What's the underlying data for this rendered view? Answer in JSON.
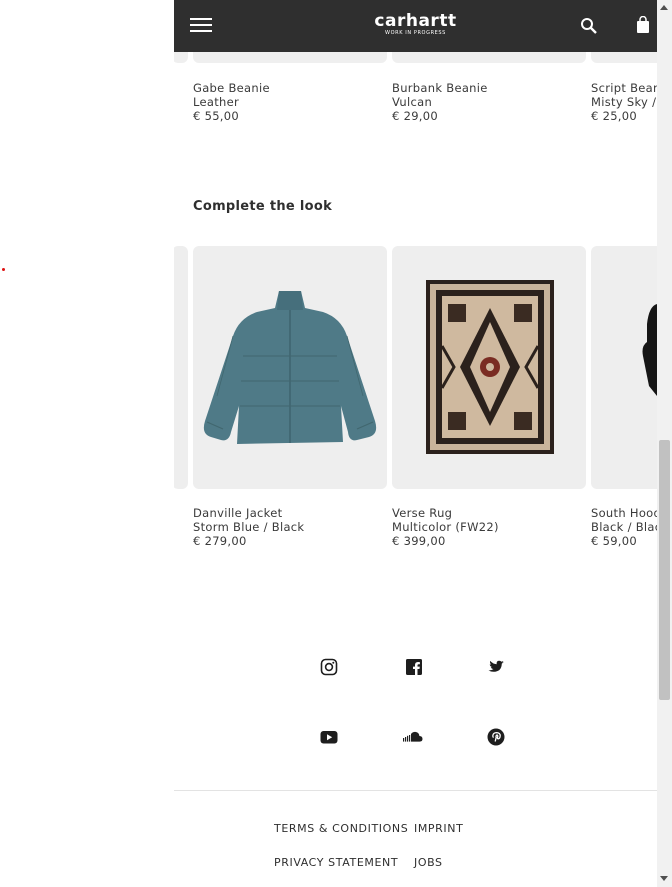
{
  "header": {
    "logo_main": "carhartt",
    "logo_sub": "WORK IN PROGRESS"
  },
  "recent_products": [
    {
      "name": "Gabe Beanie",
      "variant": "Leather",
      "price": "€ 55,00"
    },
    {
      "name": "Burbank Beanie",
      "variant": "Vulcan",
      "price": "€ 29,00"
    },
    {
      "name": "Script Beanie",
      "variant": "Misty Sky /",
      "price": "€ 25,00"
    }
  ],
  "section_title": "Complete the look",
  "look_products": [
    {
      "name": "Danville Jacket",
      "variant": "Storm Blue / Black",
      "price": "€ 279,00"
    },
    {
      "name": "Verse Rug",
      "variant": "Multicolor (FW22)",
      "price": "€ 399,00"
    },
    {
      "name": "South Hood",
      "variant": "Black / Black",
      "price": "€ 59,00"
    }
  ],
  "social_icons": [
    "instagram-icon",
    "facebook-icon",
    "twitter-icon",
    "youtube-icon",
    "soundcloud-icon",
    "pinterest-icon"
  ],
  "footer": {
    "terms": "TERMS & CONDITIONS",
    "imprint": "IMPRINT",
    "privacy": "PRIVACY STATEMENT",
    "jobs": "JOBS"
  },
  "colors": {
    "header_bg": "#2f2f2f",
    "card_bg": "#eeeeee",
    "jacket": "#4f7a87"
  }
}
